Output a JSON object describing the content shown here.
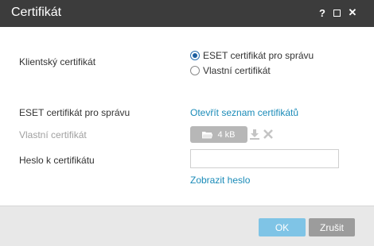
{
  "window": {
    "title": "Certifikát",
    "help_label": "?",
    "close_label": "✕"
  },
  "form": {
    "client_cert_label": "Klientský certifikát",
    "radio_options": [
      {
        "label": "ESET certifikát pro správu",
        "checked": true
      },
      {
        "label": "Vlastní certifikát",
        "checked": false
      }
    ],
    "eset_cert_label": "ESET certifikát pro správu",
    "open_cert_list_link": "Otevřít seznam certifikátů",
    "custom_cert_label": "Vlastní certifikát",
    "file_button_size": "4 kB",
    "password_label": "Heslo k certifikátu",
    "password_value": "",
    "show_password_link": "Zobrazit heslo"
  },
  "footer": {
    "ok_label": "OK",
    "cancel_label": "Zrušit"
  },
  "colors": {
    "titlebar": "#3c3c3c",
    "link": "#1a8bb8",
    "ok_button": "#7fc4e6",
    "cancel_button": "#9c9c9c",
    "footer": "#e8e8e8"
  },
  "icons": [
    "help-icon",
    "maximize-icon",
    "close-icon",
    "folder-icon",
    "download-icon",
    "remove-icon"
  ]
}
